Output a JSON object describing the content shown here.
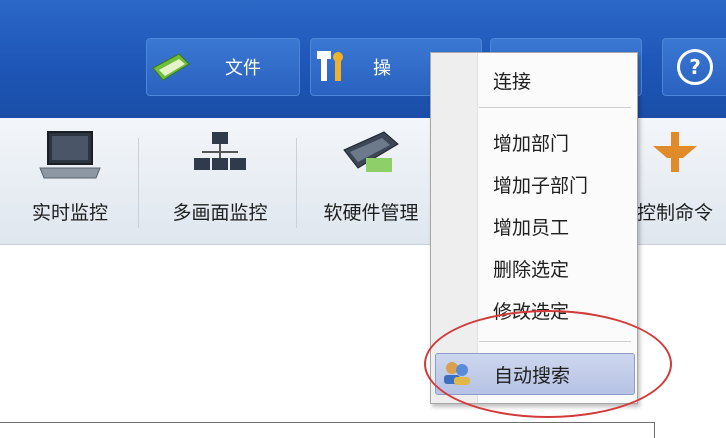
{
  "menubar": {
    "file_label": "文件",
    "ops_label": "操"
  },
  "toolbar": {
    "items": [
      {
        "label": "实时监控"
      },
      {
        "label": "多画面监控"
      },
      {
        "label": "软硬件管理"
      },
      {
        "label": "控制命令"
      }
    ]
  },
  "context_menu": {
    "items": [
      {
        "label": "连接"
      },
      {
        "label": "增加部门"
      },
      {
        "label": "增加子部门"
      },
      {
        "label": "增加员工"
      },
      {
        "label": "删除选定"
      },
      {
        "label": "修改选定"
      },
      {
        "label": "自动搜索"
      }
    ],
    "highlighted": "自动搜索"
  },
  "colors": {
    "menubar_blue": "#1e56b7",
    "highlight_ellipse": "#d33a3a",
    "selected_item": "#b6c3e4"
  }
}
